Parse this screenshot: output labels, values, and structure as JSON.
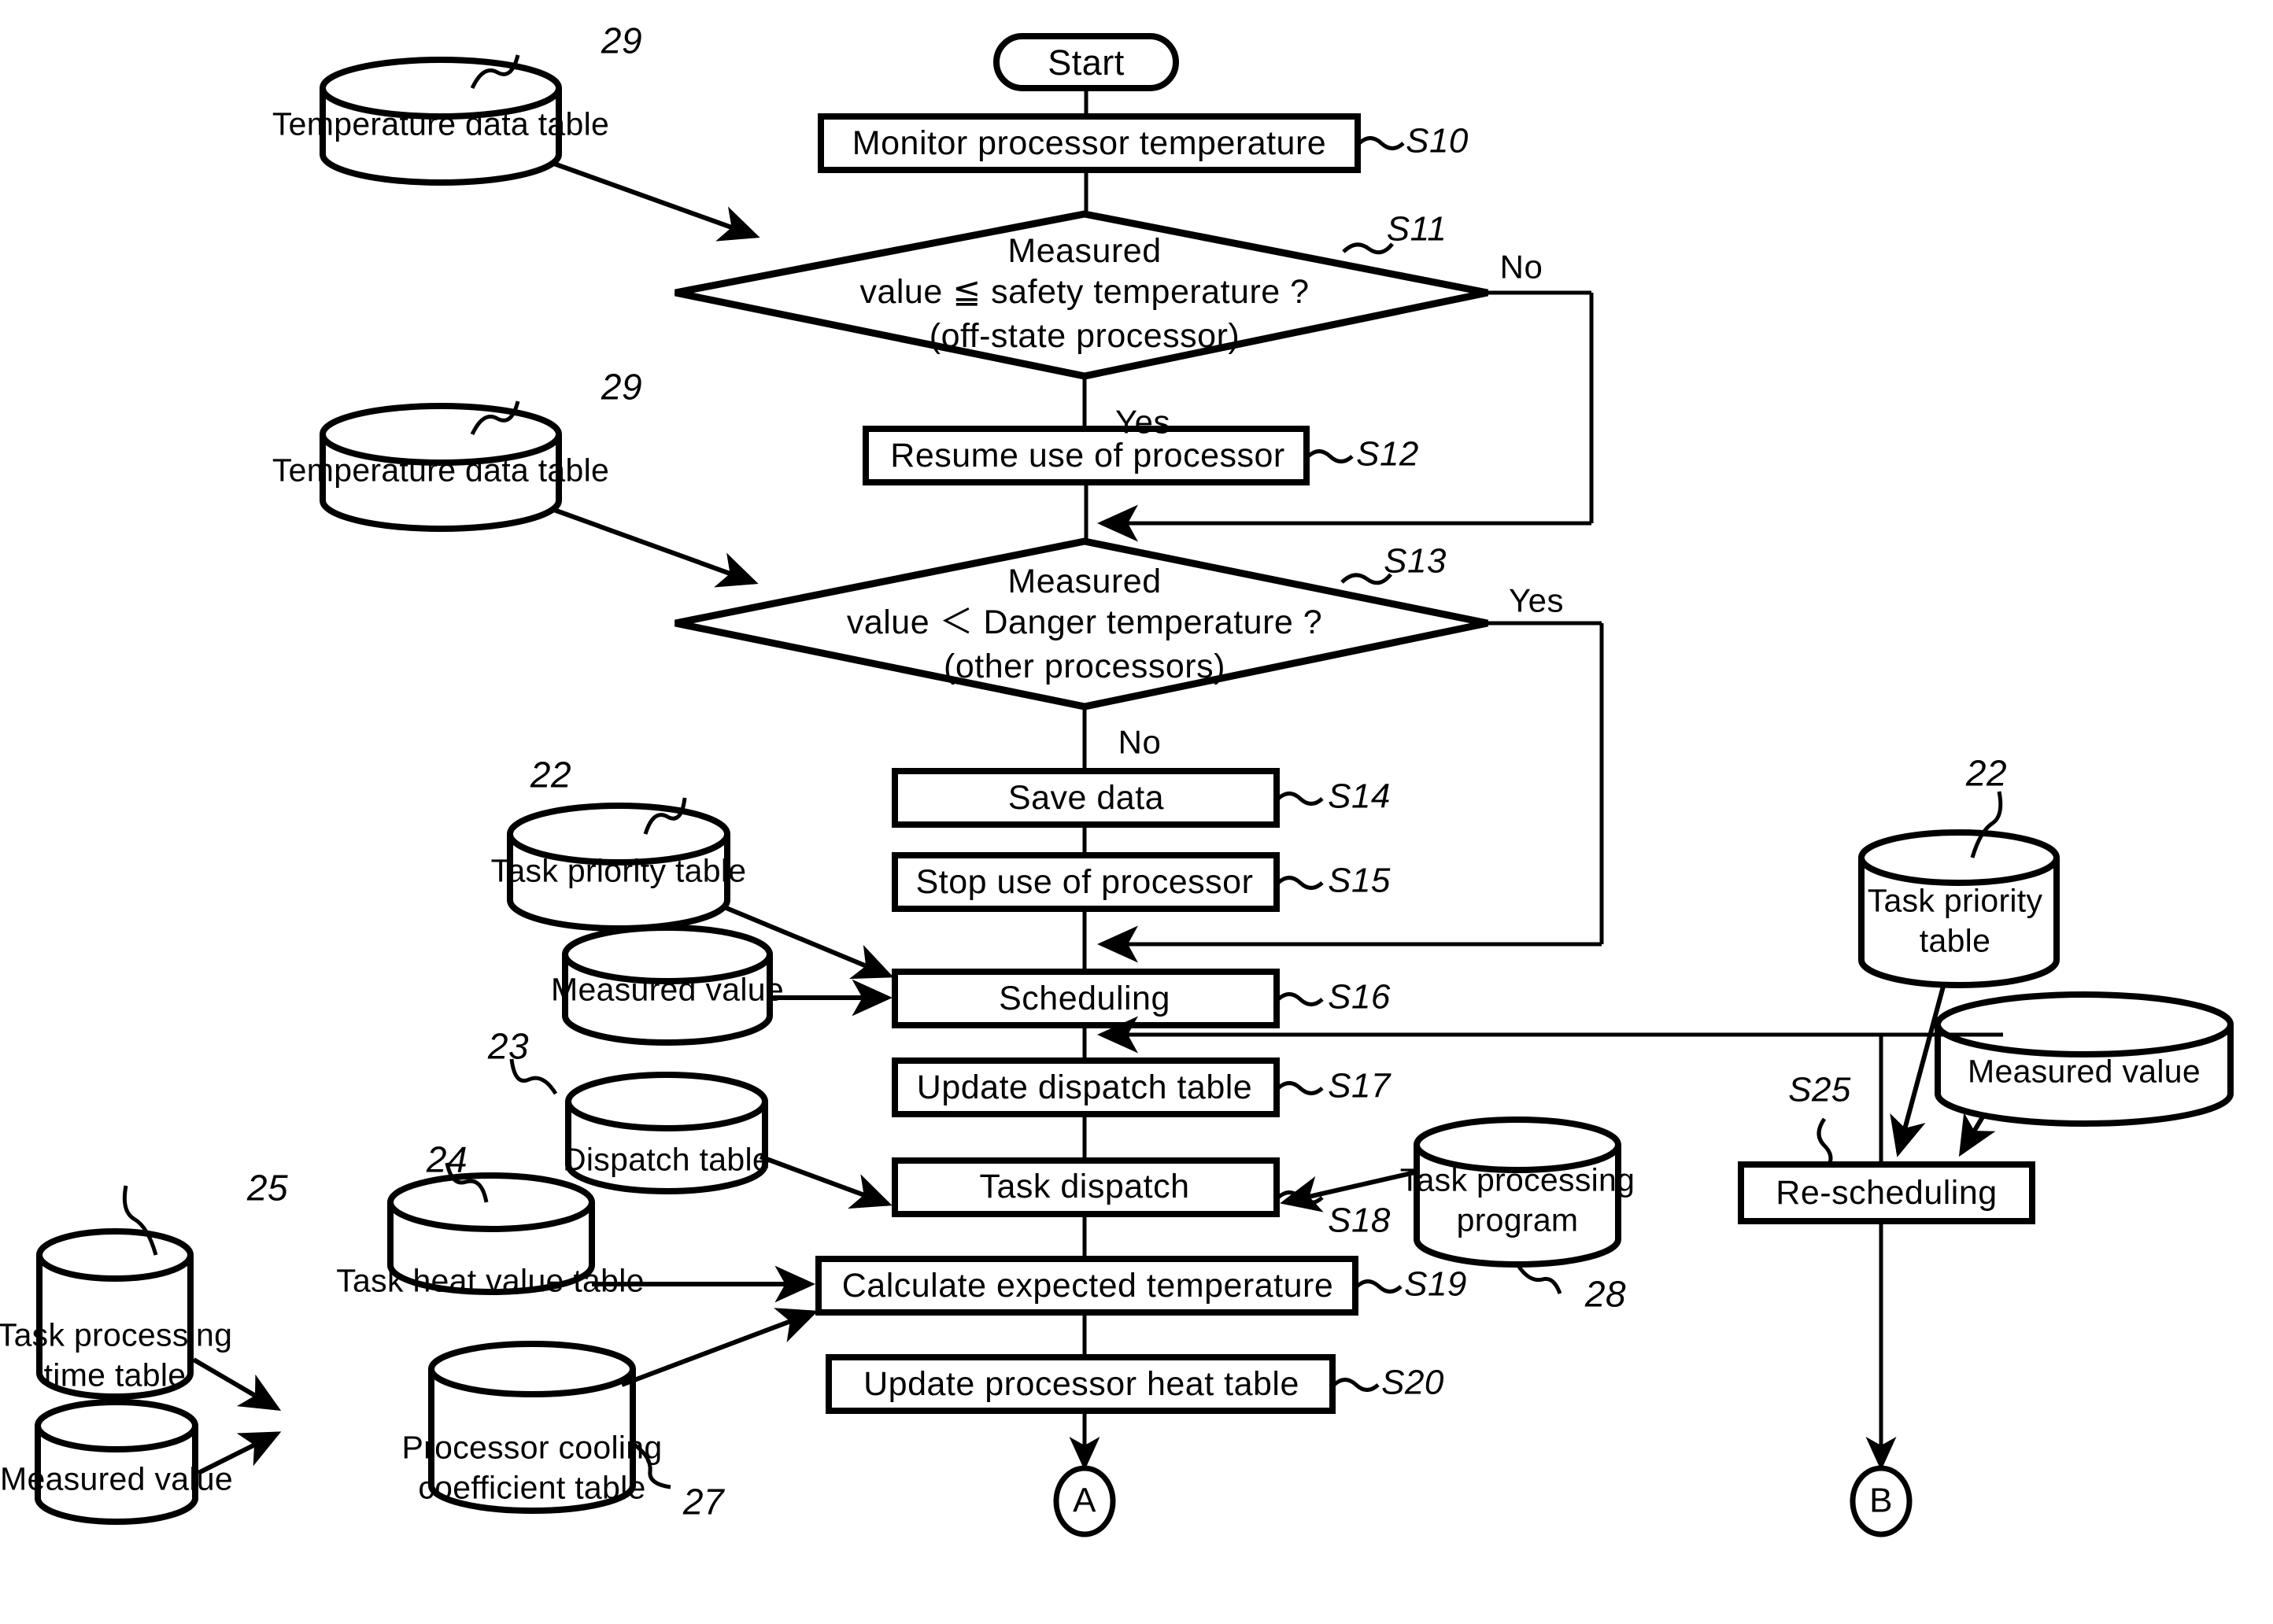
{
  "diagram": {
    "type": "flowchart",
    "title": "Processor temperature management task scheduling flowchart",
    "terminator_start": "Start",
    "connector_a": "A",
    "connector_b": "B"
  },
  "process_steps": [
    {
      "id": "S10",
      "label": "Monitor processor temperature",
      "tag": "S10"
    },
    {
      "id": "S12",
      "label": "Resume use of processor",
      "tag": "S12"
    },
    {
      "id": "S14",
      "label": "Save data",
      "tag": "S14"
    },
    {
      "id": "S15",
      "label": "Stop use of processor",
      "tag": "S15"
    },
    {
      "id": "S16",
      "label": "Scheduling",
      "tag": "S16"
    },
    {
      "id": "S17",
      "label": "Update dispatch table",
      "tag": "S17"
    },
    {
      "id": "S18",
      "label": "Task dispatch",
      "tag": "S18"
    },
    {
      "id": "S19",
      "label": "Calculate expected temperature",
      "tag": "S19"
    },
    {
      "id": "S20",
      "label": "Update processor heat table",
      "tag": "S20"
    },
    {
      "id": "S25",
      "label": "Re-scheduling",
      "tag": "S25"
    }
  ],
  "decisions": [
    {
      "id": "S11",
      "tag": "S11",
      "line1": "Measured",
      "line2": "value ≦ safety temperature ?",
      "line3": "(off-state processor)",
      "yes_label": "Yes",
      "no_label": "No"
    },
    {
      "id": "S13",
      "tag": "S13",
      "line1": "Measured",
      "line2": "value ＜ Danger temperature ?",
      "line3": "(other processors)",
      "yes_label": "Yes",
      "no_label": "No"
    }
  ],
  "data_stores": [
    {
      "id": "ds29a",
      "label": "Temperature data table",
      "ref": "29"
    },
    {
      "id": "ds29b",
      "label": "Temperature data table",
      "ref": "29"
    },
    {
      "id": "ds22a",
      "label": "Task priority table",
      "ref": "22"
    },
    {
      "id": "dsmv1",
      "label": "Measured value",
      "ref": ""
    },
    {
      "id": "ds23",
      "label": "Dispatch table",
      "ref": "23"
    },
    {
      "id": "ds24",
      "label": "Task heat value table",
      "ref": "24"
    },
    {
      "id": "ds25",
      "label_line1": "Task processing",
      "label_line2": "time table",
      "ref": "25"
    },
    {
      "id": "dsmv2",
      "label": "Measured value",
      "ref": ""
    },
    {
      "id": "ds27",
      "label_line1": "Processor cooling",
      "label_line2": "coefficient table",
      "ref": "27"
    },
    {
      "id": "ds28",
      "label_line1": "Task processing",
      "label_line2": "program",
      "ref": "28"
    },
    {
      "id": "ds22b",
      "label_line1": "Task priority",
      "label_line2": "table",
      "ref": "22"
    },
    {
      "id": "dsmv3",
      "label": "Measured value",
      "ref": ""
    }
  ],
  "reference_numbers": [
    "29",
    "29",
    "22",
    "23",
    "24",
    "25",
    "27",
    "28",
    "22"
  ],
  "colors": {
    "ink": "#000000",
    "paper": "#ffffff"
  }
}
